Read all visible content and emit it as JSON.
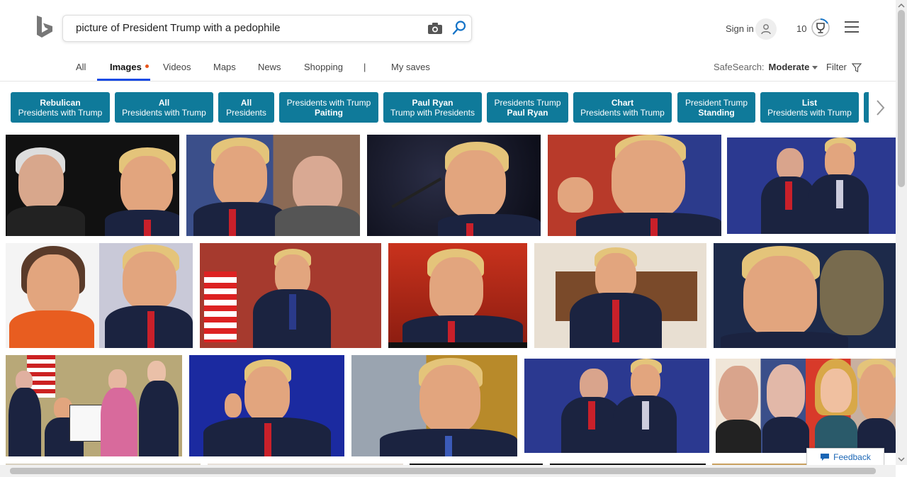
{
  "search": {
    "query": "picture of President Trump with a pedophile"
  },
  "account": {
    "sign_in": "Sign in",
    "rewards_count": "10"
  },
  "nav": {
    "tabs": [
      {
        "label": "All"
      },
      {
        "label": "Images"
      },
      {
        "label": "Videos"
      },
      {
        "label": "Maps"
      },
      {
        "label": "News"
      },
      {
        "label": "Shopping"
      },
      {
        "label": "|"
      },
      {
        "label": "My saves"
      }
    ],
    "safesearch_label": "SafeSearch:",
    "safesearch_value": "Moderate",
    "filter_label": "Filter"
  },
  "pills": [
    {
      "line1": "Rebulican",
      "line2": "Presidents with Trump"
    },
    {
      "line1": "All",
      "line2": "Presidents with Trump"
    },
    {
      "line1": "All",
      "line2": "Presidents"
    },
    {
      "line1": "Presidents with Trump",
      "line2": "Paiting"
    },
    {
      "line1": "Paul Ryan",
      "line2": "Trump with Presidents"
    },
    {
      "line1": "Presidents Trump",
      "line2": "Paul Ryan"
    },
    {
      "line1": "Chart",
      "line2": "Presidents with Trump"
    },
    {
      "line1": "President Trump",
      "line2": "Standing"
    },
    {
      "line1": "List",
      "line2": "Presidents with Trump"
    }
  ],
  "feedback": {
    "label": "Feedback"
  },
  "colors": {
    "pill_bg": "#0f7a9a",
    "accent": "#174ae4",
    "dot": "#e8541a"
  }
}
